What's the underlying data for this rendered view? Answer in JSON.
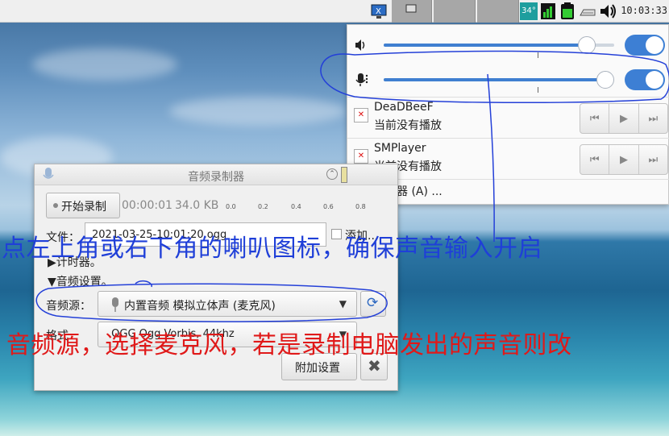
{
  "topbar": {
    "clock": "10:03:33",
    "temperature": "34°",
    "icons": [
      "monitor-icon",
      "window-icon",
      "temperature-icon",
      "cpu-icon",
      "battery-icon",
      "keyboard-icon",
      "speaker-icon"
    ]
  },
  "volume_popup": {
    "output": {
      "icon": "speaker-icon",
      "level": 0.88,
      "enabled": true
    },
    "input": {
      "icon": "microphone-icon",
      "level": 0.96,
      "enabled": true
    },
    "players": [
      {
        "name": "DeaDBeeF",
        "status": "当前没有播放"
      },
      {
        "name": "SMPlayer",
        "status": "当前没有播放"
      }
    ],
    "mixer_label": "混音器 (A) ..."
  },
  "recorder": {
    "title": "音频录制器",
    "start_button": "开始录制",
    "elapsed": "00:00:01",
    "size": "34.0 KB",
    "level_scale": [
      "0.0",
      "0.2",
      "0.4",
      "0.6",
      "0.8"
    ],
    "file_label": "文件：",
    "filename": "2021-03-25-10:01:20.ogg",
    "add_label": "添加...",
    "timer_section": "计时器。",
    "audio_settings_section": "音频设置。",
    "source_label": "音频源：",
    "source_value": "内置音频 模拟立体声 (麦克风)",
    "format_label": "格式",
    "format_value": ".OGG  Ogg Vorbis, 44khz",
    "extra_settings_button": "附加设置"
  },
  "annotations": {
    "blue": "点左上角或右下角的喇叭图标，确保声音输入开启",
    "red": "音频源，选择麦克风，若是录制电脑发出的声音则改"
  },
  "colors": {
    "annotation_blue": "#1f3fd8",
    "annotation_red": "#e01919",
    "toggle_on": "#3d7fd4"
  }
}
